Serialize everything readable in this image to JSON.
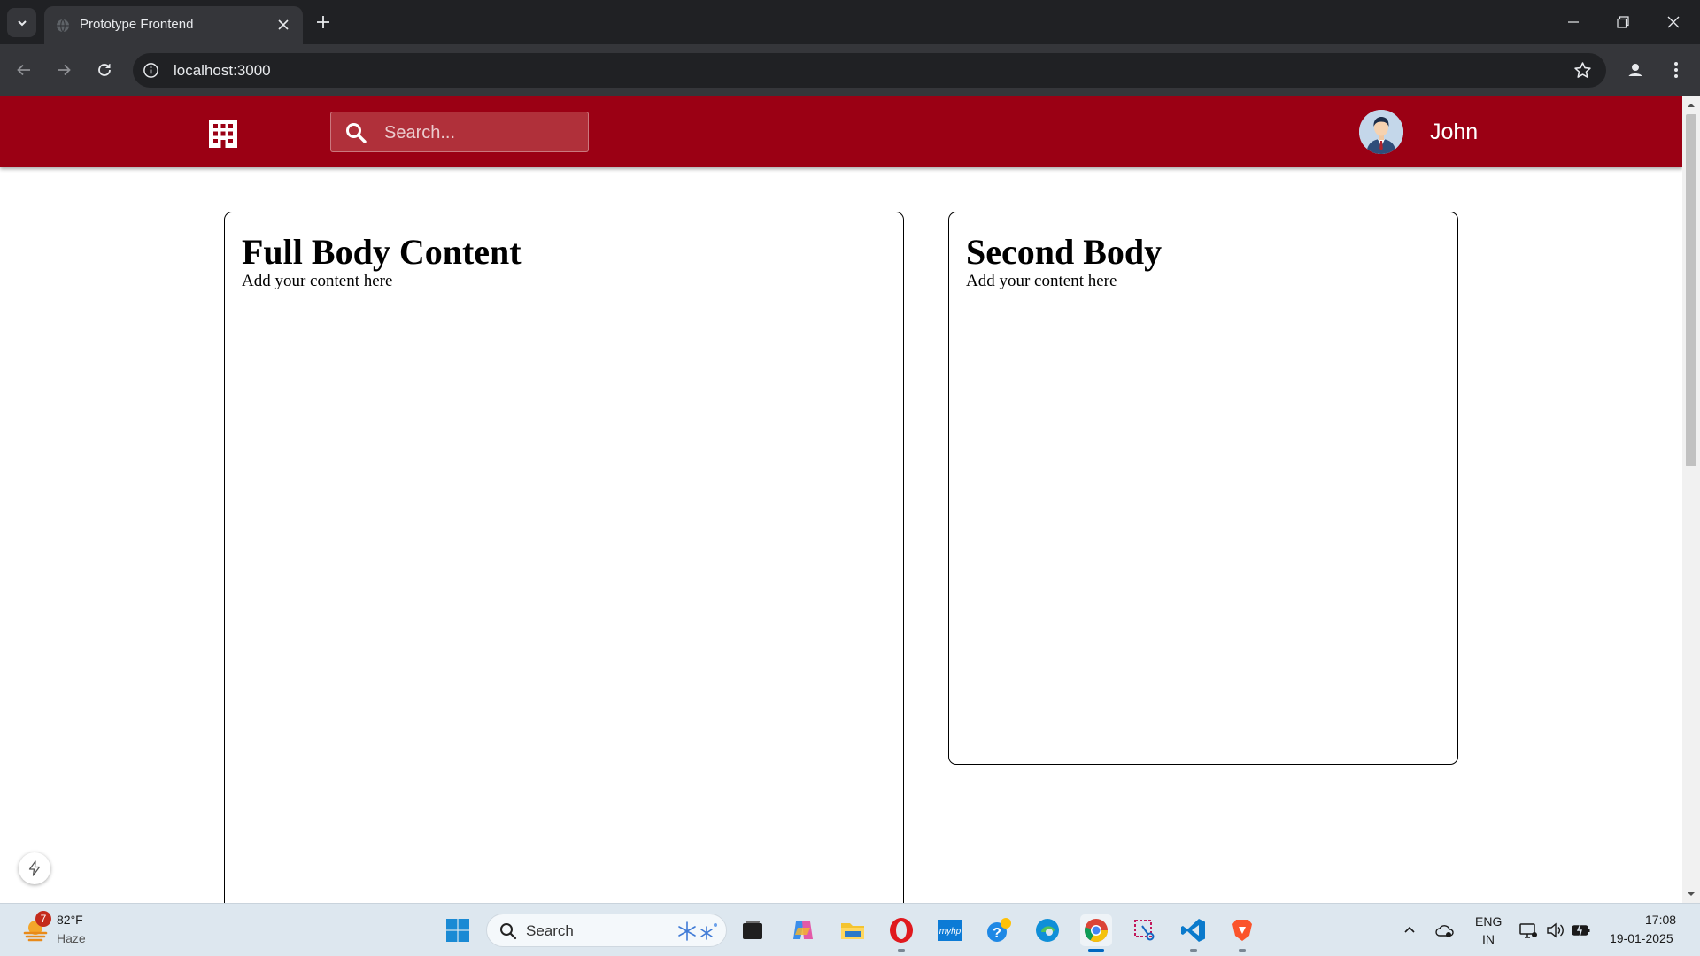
{
  "browser": {
    "tab_title": "Prototype Frontend",
    "url": "localhost:3000"
  },
  "app": {
    "search_placeholder": "Search...",
    "username": "John",
    "accent_color": "#9b0014"
  },
  "cards": [
    {
      "title": "Full Body Content",
      "body": "Add your content here"
    },
    {
      "title": "Second Body",
      "body": "Add your content here"
    }
  ],
  "taskbar": {
    "weather_badge": "7",
    "weather_temp": "82°F",
    "weather_condition": "Haze",
    "search_label": "Search",
    "language": "ENG",
    "region": "IN",
    "time": "17:08",
    "date": "19-01-2025",
    "pinned_icons": [
      "windows-start-icon",
      "search",
      "task-view-icon",
      "copilot-icon",
      "file-explorer-icon",
      "opera-icon",
      "myhp-icon",
      "help-icon",
      "edge-icon",
      "chrome-icon",
      "snipping-tool-icon",
      "vscode-icon",
      "brave-icon"
    ]
  }
}
